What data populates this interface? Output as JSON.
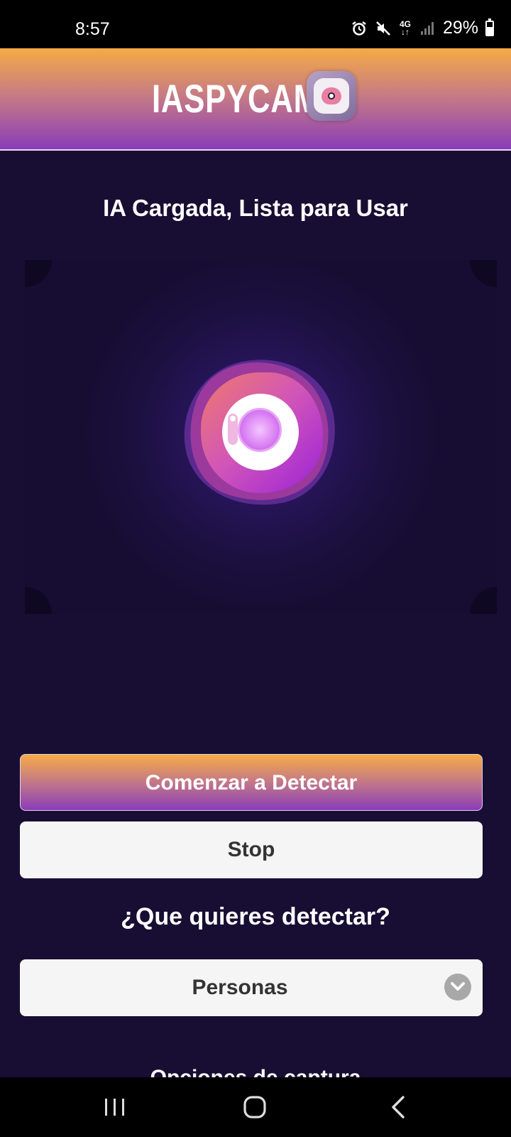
{
  "status_bar": {
    "time": "8:57",
    "network_label": "4G",
    "battery_text": "29%",
    "icons": [
      "alarm-icon",
      "mute-icon",
      "network-4g-icon",
      "signal-icon",
      "battery-icon"
    ]
  },
  "header": {
    "logo_text": "IASPYCAM",
    "logo_badge_icon": "brain-eye-icon"
  },
  "main": {
    "status_text": "IA Cargada, Lista para Usar",
    "camera_icon": "camera-icon"
  },
  "buttons": {
    "start_label": "Comenzar a Detectar",
    "stop_label": "Stop"
  },
  "detect": {
    "question": "¿Que quieres detectar?",
    "selected": "Personas"
  },
  "capture": {
    "label": "Opciones de captura"
  },
  "navbar": {
    "icons": [
      "recent-apps-icon",
      "home-icon",
      "back-icon"
    ]
  },
  "colors": {
    "background": "#180e33",
    "gradient_top": "#f6ab45",
    "gradient_bottom": "#8a3cb8",
    "button_light": "#f5f5f5"
  }
}
